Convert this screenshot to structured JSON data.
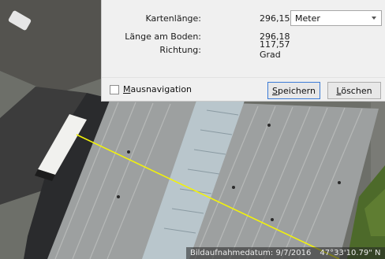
{
  "measure": {
    "map_length_label": "Kartenlänge:",
    "map_length_value": "296,15",
    "unit_selected": "Meter",
    "ground_length_label": "Länge am Boden:",
    "ground_length_value": "296,18",
    "heading_label": "Richtung:",
    "heading_value": "117,57 Grad",
    "mouse_nav_rest": "ausnavigation",
    "mouse_nav_mnemonic": "M",
    "mouse_nav_checked": false,
    "save_mnemonic": "S",
    "save_rest": "peichern",
    "delete_mnemonic": "L",
    "delete_rest": "öschen"
  },
  "statusbar": {
    "imagery_date": "Bildaufnahmedatum: 9/7/2016",
    "coordinate": "47°33'10.79\" N"
  },
  "colors": {
    "ruler_line": "#f2f20a",
    "dialog_bg": "#f0f0f0",
    "accent_button_border": "#3b7bd6"
  }
}
